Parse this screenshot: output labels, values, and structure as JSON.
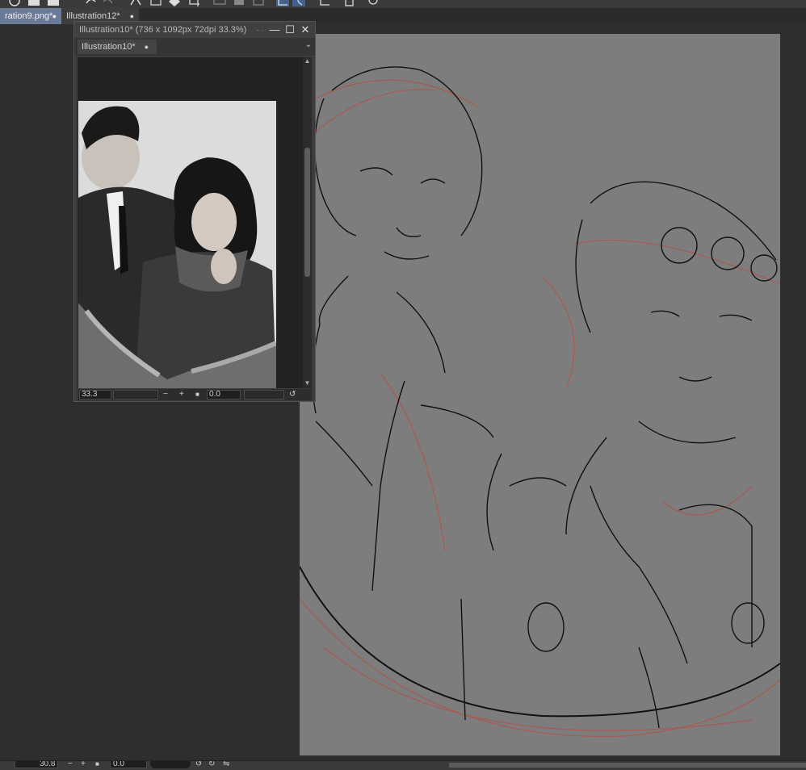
{
  "app": {
    "accent_color": "#6a7a98",
    "canvas_bg": "#7d7d7d",
    "workspace_bg": "#2e2e2e"
  },
  "toolbar": {
    "icons": [
      "globe-icon",
      "folder-icon",
      "save-icon",
      "undo-icon",
      "redo-icon",
      "brush-icon",
      "transform-icon",
      "fill-icon",
      "crop-icon",
      "ruler-icon",
      "layer-icon",
      "select-icon",
      "lasso-icon",
      "frame-icon",
      "phone-icon",
      "chat-icon"
    ]
  },
  "doc_tabs": [
    {
      "label": "ration9.png*",
      "marker": "●"
    },
    {
      "label": "Illustration12*",
      "marker": "●"
    }
  ],
  "subview": {
    "title": "Illustration10* (736 x 1092px 72dpi 33.3%)",
    "title_suffix": "- ·",
    "minimize": "—",
    "maximize": "☐",
    "close": "✕",
    "tab_label": "Illustration10*",
    "tab_marker": "●",
    "dropdown": "⌄",
    "footer": {
      "zoom": "33.3",
      "zoom_out": "−",
      "zoom_in": "+",
      "fit": "■",
      "rotation": "0.0"
    }
  },
  "statusbar": {
    "zoom": "30.8",
    "rotation": "0.0"
  }
}
